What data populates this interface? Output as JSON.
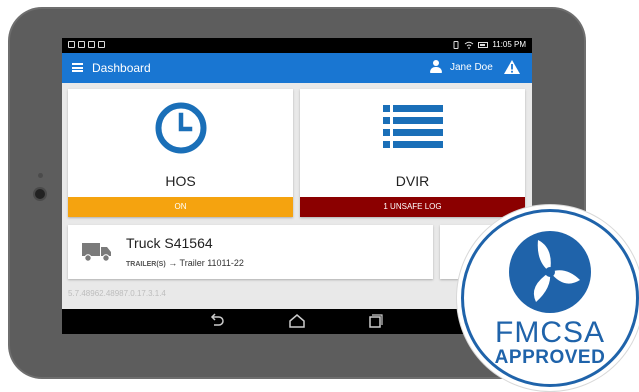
{
  "statusbar": {
    "time": "11:05 PM"
  },
  "appbar": {
    "title": "Dashboard",
    "user": "Jane Doe"
  },
  "cards": {
    "hos": {
      "label": "HOS",
      "status": "ON"
    },
    "dvir": {
      "label": "DVIR",
      "status": "1 UNSAFE LOG"
    },
    "truck": {
      "name": "Truck S41564",
      "trailer_key": "TRAILER(S)",
      "trailer_arrow": "→",
      "trailer_value": "Trailer 11011-22"
    }
  },
  "version": "5.7.48962.48987.0.17.3.1.4",
  "badge": {
    "line1": "FMCSA",
    "line2": "APPROVED"
  },
  "colors": {
    "primary": "#1976d2",
    "on_status": "#f5a30f",
    "unsafe_status": "#8b0000",
    "badge": "#1f63aa"
  },
  "icons": {
    "menu": "menu-icon",
    "user": "user-icon",
    "alert": "alert-triangle-icon",
    "hos": "clock-icon",
    "dvir": "list-icon",
    "truck": "truck-icon"
  }
}
